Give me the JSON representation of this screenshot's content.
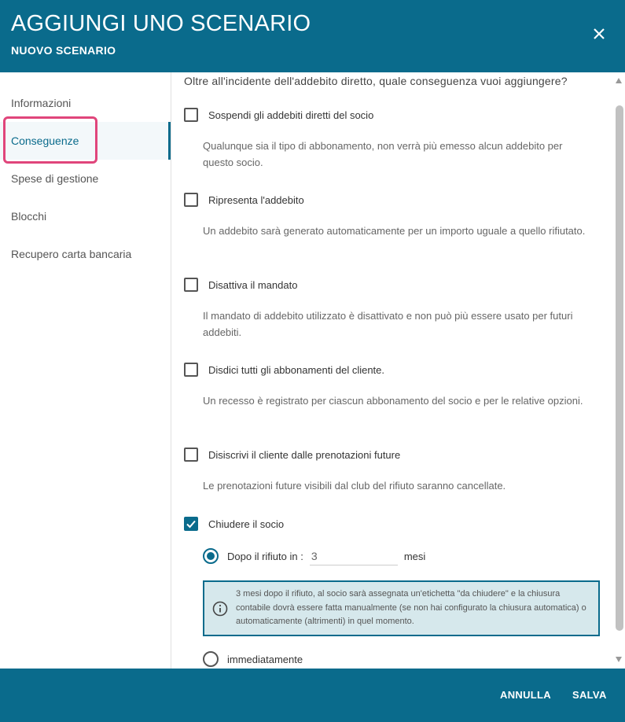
{
  "header": {
    "title": "AGGIUNGI UNO SCENARIO",
    "subtitle": "NUOVO SCENARIO",
    "close_icon": "close-icon"
  },
  "sidebar": {
    "items": [
      {
        "label": "Informazioni",
        "active": false
      },
      {
        "label": "Conseguenze",
        "active": true
      },
      {
        "label": "Spese di gestione",
        "active": false
      },
      {
        "label": "Blocchi",
        "active": false
      },
      {
        "label": "Recupero carta bancaria",
        "active": false
      }
    ]
  },
  "content": {
    "question": "Oltre all'incidente dell'addebito diretto, quale conseguenza vuoi aggiungere?",
    "options": [
      {
        "label": "Sospendi gli addebiti diretti del socio",
        "checked": false,
        "description": "Qualunque sia il tipo di abbonamento, non verrà più emesso alcun addebito per questo socio."
      },
      {
        "label": "Ripresenta l'addebito",
        "checked": false,
        "description": "Un addebito sarà generato automaticamente per un importo uguale a quello rifiutato."
      },
      {
        "label": "Disattiva il mandato",
        "checked": false,
        "description": "Il mandato di addebito utilizzato è disattivato e non può più essere usato per futuri addebiti."
      },
      {
        "label": "Disdici tutti gli abbonamenti del cliente.",
        "checked": false,
        "description": "Un recesso è registrato per ciascun abbonamento del socio e per le relative opzioni."
      },
      {
        "label": "Disiscrivi il cliente dalle prenotazioni future",
        "checked": false,
        "description": "Le prenotazioni future visibili dal club del rifiuto saranno cancellate."
      },
      {
        "label": "Chiudere il socio",
        "checked": true,
        "description": ""
      }
    ],
    "close_member": {
      "after_label": "Dopo il rifiuto in :",
      "after_value": "3",
      "after_unit": "mesi",
      "after_selected": true,
      "info_text": "3 mesi dopo il rifiuto, al socio sarà assegnata un'etichetta \"da chiudere\" e la chiusura contabile dovrà essere fatta manualmente (se non hai configurato la chiusura automatica) o automaticamente (altrimenti) in quel momento.",
      "immediate_label": "immediatamente",
      "immediate_selected": false
    }
  },
  "footer": {
    "cancel_label": "ANNULLA",
    "save_label": "SALVA"
  },
  "colors": {
    "primary": "#0a6b8c",
    "highlight": "#e0457b",
    "info_bg": "#d6e8ec"
  }
}
